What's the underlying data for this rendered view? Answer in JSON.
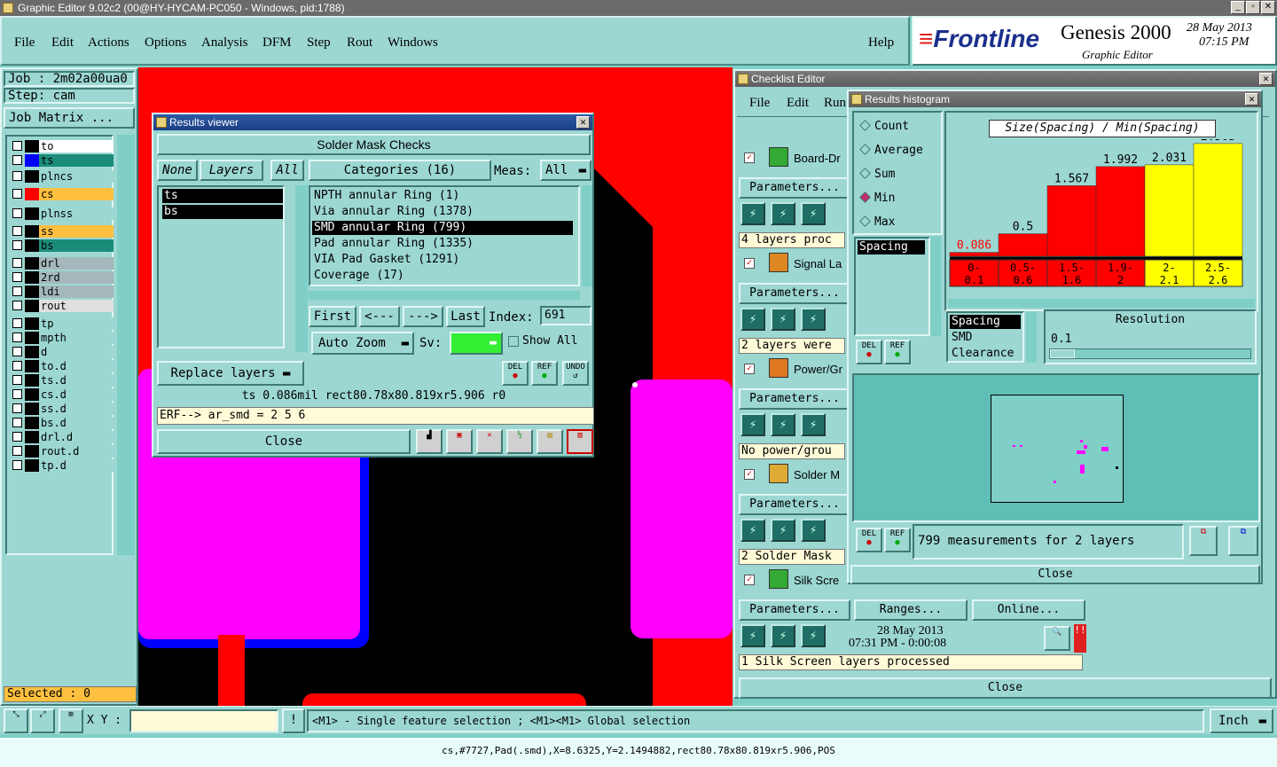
{
  "window": {
    "title": "Graphic Editor 9.02c2 (00@HY-HYCAM-PC050 - Windows, pid:1788)"
  },
  "menu": {
    "items": [
      "File",
      "Edit",
      "Actions",
      "Options",
      "Analysis",
      "DFM",
      "Step",
      "Rout",
      "Windows"
    ],
    "help": "Help"
  },
  "brand": {
    "logo": "Frontline",
    "product": "Genesis 2000",
    "subtitle": "Graphic Editor",
    "date": "28 May 2013",
    "time": "07:15 PM"
  },
  "left": {
    "job": "Job : 2m02a00ua0",
    "step": "Step: cam",
    "job_matrix": "Job Matrix ...",
    "selected": "Selected : 0",
    "layers": [
      {
        "name": "to",
        "color": "#000000",
        "bg": "#ffffff"
      },
      {
        "name": "ts",
        "color": "#0000ff",
        "bg": "#1c8c7a"
      },
      {
        "name": "plncs",
        "color": "#000000",
        "bg": "#9cd7d2"
      },
      {
        "name": "cs",
        "color": "#ff0000",
        "bg": "#ffc040"
      },
      {
        "name": "plnss",
        "color": "#000000",
        "bg": "#9cd7d2"
      },
      {
        "name": "ss",
        "color": "#000000",
        "bg": "#ffc040"
      },
      {
        "name": "bs",
        "color": "#000000",
        "bg": "#1c8c7a"
      },
      {
        "name": "drl",
        "color": "#000000",
        "bg": "#a4b8bc"
      },
      {
        "name": "2rd",
        "color": "#000000",
        "bg": "#a4b8bc"
      },
      {
        "name": "ldi",
        "color": "#000000",
        "bg": "#a4b8bc"
      },
      {
        "name": "rout",
        "color": "#000000",
        "bg": "#e0e0e0"
      },
      {
        "name": "tp",
        "color": "#000000",
        "bg": "#9cd7d2"
      },
      {
        "name": "mpth",
        "color": "#000000",
        "bg": "#9cd7d2"
      },
      {
        "name": "d",
        "color": "#000000",
        "bg": "#9cd7d2"
      },
      {
        "name": "to.d",
        "color": "#000000",
        "bg": "#9cd7d2"
      },
      {
        "name": "ts.d",
        "color": "#000000",
        "bg": "#9cd7d2"
      },
      {
        "name": "cs.d",
        "color": "#000000",
        "bg": "#9cd7d2"
      },
      {
        "name": "ss.d",
        "color": "#000000",
        "bg": "#9cd7d2"
      },
      {
        "name": "bs.d",
        "color": "#000000",
        "bg": "#9cd7d2"
      },
      {
        "name": "drl.d",
        "color": "#000000",
        "bg": "#9cd7d2"
      },
      {
        "name": "rout.d",
        "color": "#000000",
        "bg": "#9cd7d2"
      },
      {
        "name": "tp.d",
        "color": "#000000",
        "bg": "#9cd7d2"
      }
    ]
  },
  "results_viewer": {
    "title": "Results viewer",
    "header": "Solder Mask Checks",
    "none": "None",
    "layers": "Layers",
    "all": "All",
    "categories": "Categories (16)",
    "meas_label": "Meas:",
    "meas_value": "All",
    "layer_list": [
      "ts",
      "bs"
    ],
    "category_list": [
      "NPTH annular Ring (1)",
      "Via annular Ring (1378)",
      "SMD annular Ring (799)",
      "Pad annular Ring (1335)",
      "VIA Pad Gasket (1291)",
      "Coverage (17)"
    ],
    "first": "First",
    "prev": "<---",
    "next": "--->",
    "last": "Last",
    "index_label": "Index:",
    "index_value": "691",
    "auto_zoom": "Auto Zoom",
    "sv": "Sv:",
    "show_all": "Show All",
    "replace_layers": "Replace layers",
    "del": "DEL",
    "ref": "REF",
    "undo": "UNDO",
    "status": "ts 0.086mil  rect80.78x80.819xr5.906  r0",
    "erf": "ERF--> ar_smd = 2 5 6",
    "close": "Close"
  },
  "checklist": {
    "title": "Checklist Editor",
    "menu": [
      "File",
      "Edit",
      "Run"
    ],
    "parameters": "Parameters...",
    "ranges": "Ranges...",
    "online": "Online...",
    "close": "Close",
    "items": [
      {
        "name": "Board-Dr",
        "status": "4 layers proc"
      },
      {
        "name": "Signal La",
        "status": "2 layers were"
      },
      {
        "name": "Power/Gr",
        "status": "No power/grou"
      },
      {
        "name": "Solder M",
        "status": "2 Solder Mask"
      },
      {
        "name": "Silk Scre",
        "status": "1 Silk Screen layers processed"
      }
    ],
    "date": "28 May 2013",
    "time": "07:31 PM - 0:00:08"
  },
  "histogram": {
    "title": "Results histogram",
    "options": [
      "Count",
      "Average",
      "Sum",
      "Min",
      "Max"
    ],
    "selected": "Min",
    "list": [
      "Spacing"
    ],
    "chart_title": "Size(Spacing) / Min(Spacing)",
    "bars": [
      {
        "label": "0.086",
        "value": 0.086,
        "range": "0-\n0.1",
        "color": "#ff0000"
      },
      {
        "label": "0.5",
        "value": 0.5,
        "range": "0.5-\n0.6",
        "color": "#ff0000"
      },
      {
        "label": "1.567",
        "value": 1.567,
        "range": "1.5-\n1.6",
        "color": "#ff0000"
      },
      {
        "label": "1.992",
        "value": 1.992,
        "range": "1.9-\n2",
        "color": "#ff0000"
      },
      {
        "label": "2.031",
        "value": 2.031,
        "range": "2-\n2.1",
        "color": "#ffff00"
      },
      {
        "label": "2.503",
        "value": 2.503,
        "range": "2.5-\n2.6",
        "color": "#ffff00"
      }
    ],
    "types": [
      "Spacing",
      "SMD",
      "Clearance"
    ],
    "resolution_label": "Resolution",
    "resolution_value": "0.1",
    "measurements": "799 measurements for 2 layers",
    "close": "Close"
  },
  "bottom": {
    "xy": "X Y :",
    "hint": "<M1> - Single feature selection ; <M1><M1> Global selection",
    "unit": "Inch",
    "status": "cs,#7727,Pad(.smd),X=8.6325,Y=2.1494882,rect80.78x80.819xr5.906,POS"
  }
}
